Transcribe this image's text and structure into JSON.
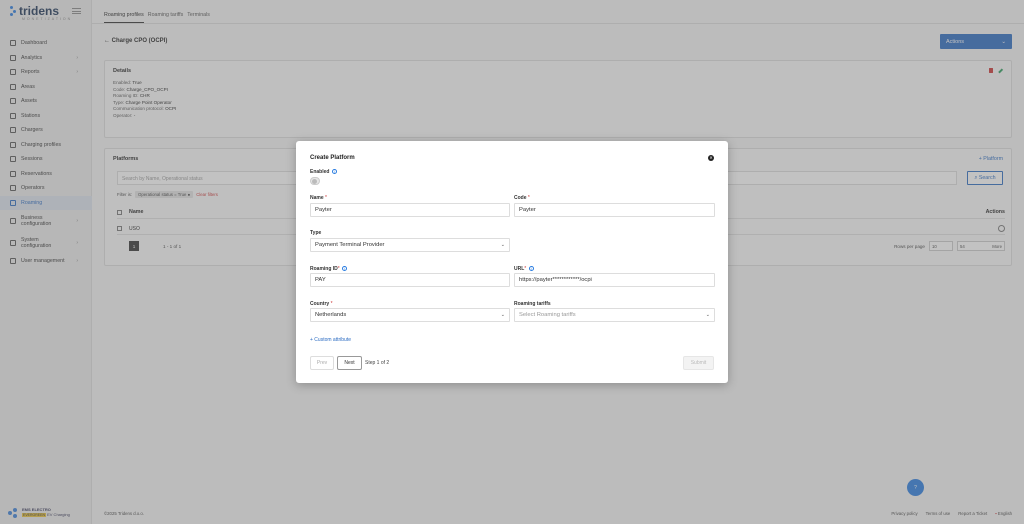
{
  "app": {
    "brand": "tridens",
    "brand_sub": "MONETIZATION"
  },
  "sidebar": {
    "items": [
      {
        "label": "Dashboard",
        "icon": "dashboard-icon",
        "chevron": false
      },
      {
        "label": "Analytics",
        "icon": "analytics-icon",
        "chevron": true
      },
      {
        "label": "Reports",
        "icon": "reports-icon",
        "chevron": true
      },
      {
        "label": "Areas",
        "icon": "areas-icon",
        "chevron": false
      },
      {
        "label": "Assets",
        "icon": "assets-icon",
        "chevron": false
      },
      {
        "label": "Stations",
        "icon": "stations-icon",
        "chevron": false
      },
      {
        "label": "Chargers",
        "icon": "chargers-icon",
        "chevron": false
      },
      {
        "label": "Charging profiles",
        "icon": "charging-profiles-icon",
        "chevron": false
      },
      {
        "label": "Sessions",
        "icon": "sessions-icon",
        "chevron": false
      },
      {
        "label": "Reservations",
        "icon": "reservations-icon",
        "chevron": false
      },
      {
        "label": "Operators",
        "icon": "operators-icon",
        "chevron": false
      },
      {
        "label": "Roaming",
        "icon": "roaming-icon",
        "chevron": false,
        "active": true
      },
      {
        "label": "Business configuration",
        "icon": "business-config-icon",
        "chevron": true
      },
      {
        "label": "System configuration",
        "icon": "system-config-icon",
        "chevron": true
      },
      {
        "label": "User management",
        "icon": "user-management-icon",
        "chevron": true
      }
    ],
    "footer": {
      "brand": "EMS ELECTRO",
      "tag": "EVERGREEN",
      "tagline": "EV Charging"
    }
  },
  "tabs": [
    "Roaming profiles",
    "Roaming tariffs",
    "Terminals"
  ],
  "page": {
    "back_title": "Charge CPO (OCPI)",
    "actions_label": "Actions",
    "details": {
      "title": "Details",
      "rows": [
        {
          "k": "Enabled:",
          "v": "True"
        },
        {
          "k": "Code:",
          "v": "Charge_CPO_OCPI"
        },
        {
          "k": "Roaming ID:",
          "v": "CHR"
        },
        {
          "k": "Type:",
          "v": "Charge Point Operator"
        },
        {
          "k": "Communication protocol:",
          "v": "OCPI"
        },
        {
          "k": "Operator:",
          "v": "-"
        }
      ]
    },
    "platforms": {
      "title": "Platforms",
      "add_label": "+ Platform",
      "search_placeholder": "Search by Name, Operational status",
      "search_button": "Search",
      "filter_label": "Filter is:",
      "filter_chip": "Operational status = True",
      "clear_filters": "Clear filters",
      "col_name": "Name",
      "col_actions": "Actions",
      "rows": [
        {
          "name": "USO"
        }
      ],
      "page_number": "1",
      "page_info": "1 - 1 of 1",
      "rows_per_page_label": "Rows per page",
      "rows_per_page_value": "10",
      "jump_value": "54",
      "more_label": "More"
    }
  },
  "footer": {
    "copyright": "©2025 Tridens d.o.o.",
    "links": [
      "Privacy policy",
      "Terms of use",
      "Report a Ticket",
      "English"
    ]
  },
  "help_fab_label": "?",
  "modal": {
    "title": "Create Platform",
    "enabled_label": "Enabled",
    "name_label": "Name",
    "name_value": "Payter",
    "code_label": "Code",
    "code_value": "Payter",
    "type_label": "Type",
    "type_value": "Payment Terminal Provider",
    "roaming_id_label": "Roaming ID",
    "roaming_id_value": "PAY",
    "url_label": "URL",
    "url_value": "https://payter************/ocpi",
    "country_label": "Country",
    "country_value": "Netherlands",
    "roaming_tariffs_label": "Roaming tariffs",
    "roaming_tariffs_placeholder": "Select Roaming tariffs",
    "custom_attribute": "+  Custom attribute",
    "prev": "Prev",
    "next": "Next",
    "step": "Step 1 of 2",
    "submit": "Submit",
    "required_mark": "*"
  },
  "colors": {
    "accent": "#2a6bc2",
    "danger": "#cc3333",
    "overlay": "rgba(110,110,110,0.42)"
  }
}
